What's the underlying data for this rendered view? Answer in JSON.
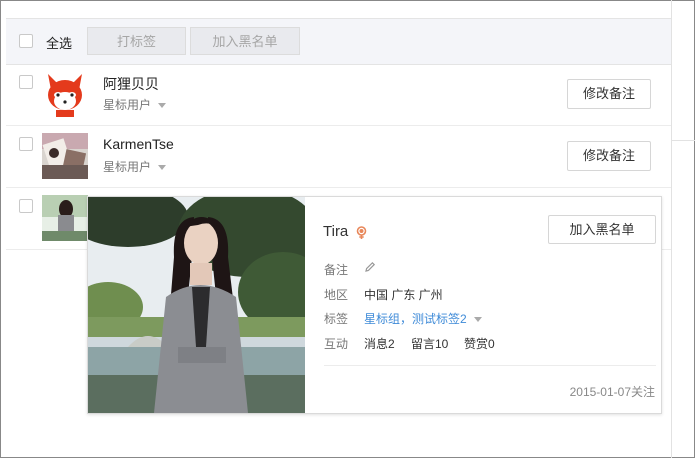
{
  "toolbar": {
    "select_all": "全选",
    "tag_button": "打标签",
    "blacklist_button": "加入黑名单"
  },
  "users": [
    {
      "name": "阿狸贝贝",
      "tag": "星标用户",
      "edit_label": "修改备注"
    },
    {
      "name": "KarmenTse",
      "tag": "星标用户",
      "edit_label": "修改备注"
    }
  ],
  "profile_card": {
    "name": "Tira",
    "blacklist_label": "加入黑名单",
    "remark_label": "备注",
    "region_label": "地区",
    "region_value": "中国 广东 广州",
    "tags_label": "标签",
    "tags_value": "星标组，测试标签2",
    "interaction_label": "互动",
    "messages": "消息2",
    "comments": "留言10",
    "rewards": "赞赏0",
    "follow_date": "2015-01-07关注"
  },
  "colors": {
    "toolbar_bg": "#f4f5f9",
    "link": "#3f8bd8",
    "gender_female": "#e8875a"
  }
}
